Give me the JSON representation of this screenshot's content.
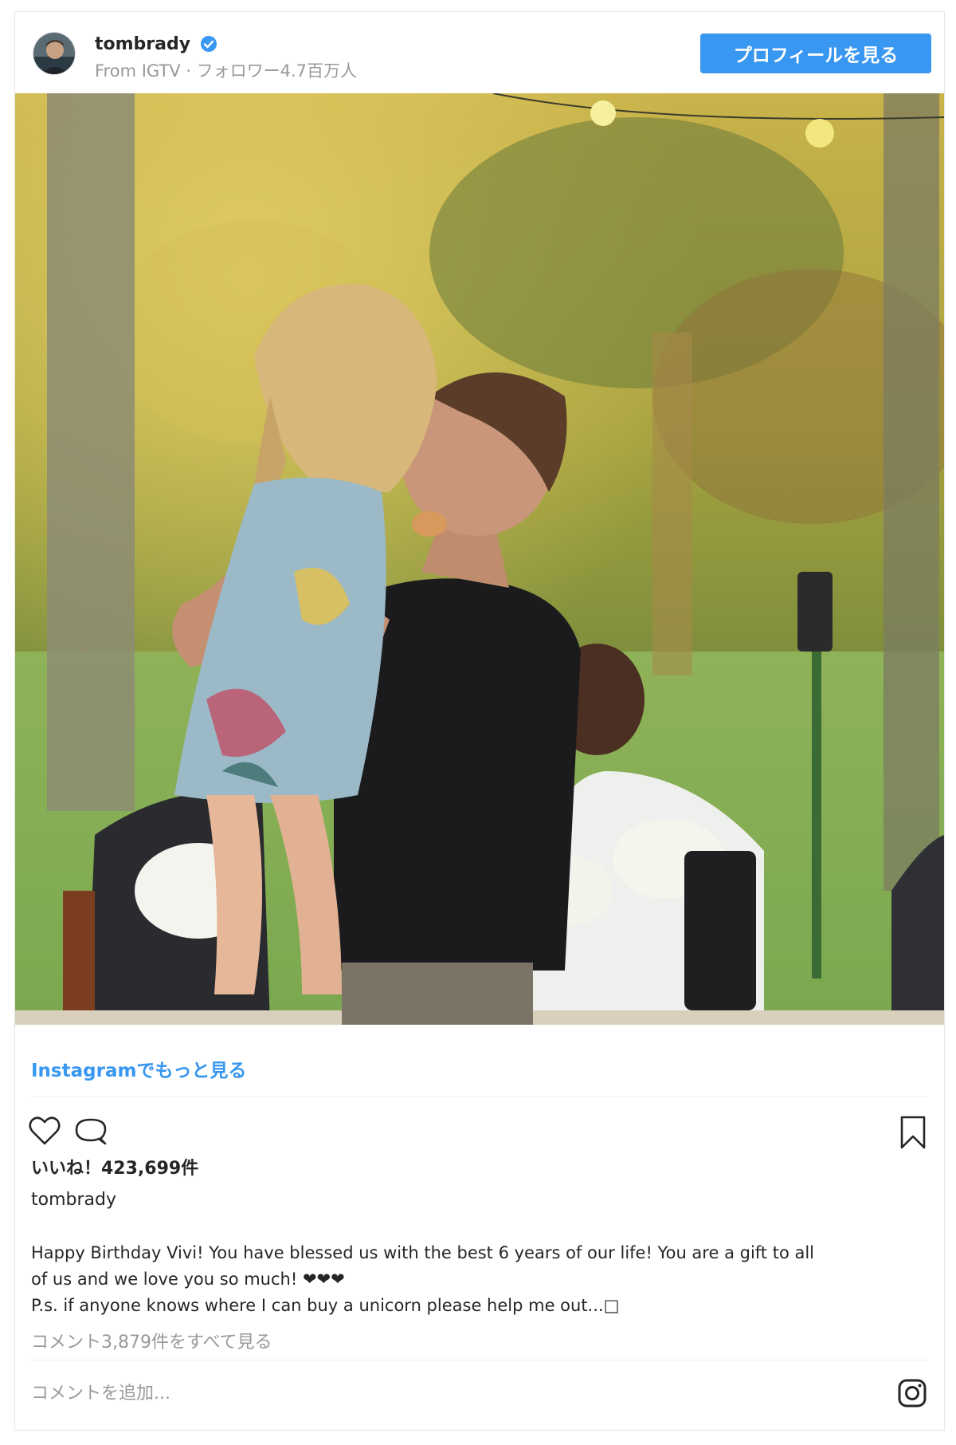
{
  "header": {
    "username": "tombrady",
    "subline": "From IGTV · フォロワー4.7百万人",
    "profile_button": "プロフィールを見る"
  },
  "post": {
    "more_link": "Instagramでもっと見る",
    "likes": "いいね！423,699件",
    "caption_user": "tombrady",
    "caption_lines": [
      "Happy Birthday Vivi! You have blessed us with the best 6 years of our life! You are a gift to all",
      "of us and we love you so much! ❤❤❤",
      "P.s. if anyone knows where I can buy a unicorn please help me out...□"
    ],
    "view_comments": "コメント3,879件をすべて見る",
    "comment_placeholder": "コメントを追加..."
  },
  "icons": {
    "verified": "verified-badge-icon",
    "like": "heart-icon",
    "comment": "comment-bubble-icon",
    "save": "bookmark-icon",
    "logo": "instagram-logo-icon"
  },
  "colors": {
    "accent": "#3897f0",
    "muted": "#999999",
    "text": "#262626"
  }
}
